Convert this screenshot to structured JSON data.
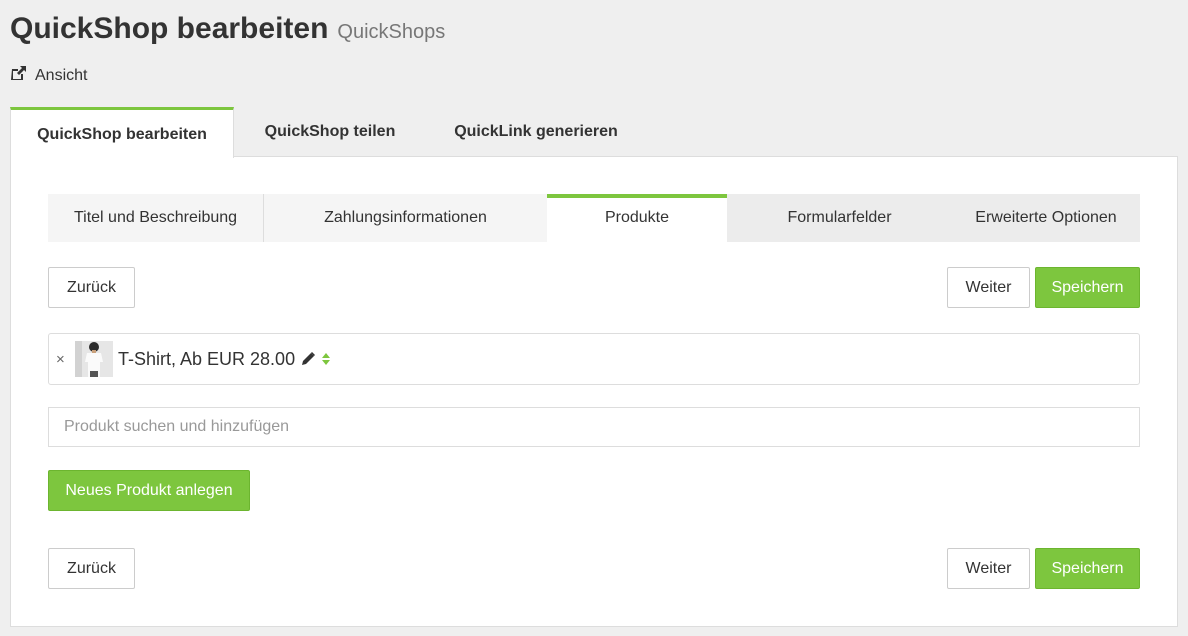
{
  "header": {
    "title": "QuickShop bearbeiten",
    "subtitle": "QuickShops",
    "view_link": "Ansicht"
  },
  "main_tabs": [
    {
      "label": "QuickShop bearbeiten",
      "active": true
    },
    {
      "label": "QuickShop teilen",
      "active": false
    },
    {
      "label": "QuickLink generieren",
      "active": false
    }
  ],
  "sub_tabs": [
    {
      "label": "Titel und Beschreibung",
      "active": false
    },
    {
      "label": "Zahlungsinformationen",
      "active": false
    },
    {
      "label": "Produkte",
      "active": true
    },
    {
      "label": "Formularfelder",
      "active": false
    },
    {
      "label": "Erweiterte Optionen",
      "active": false
    }
  ],
  "actions": {
    "back": "Zurück",
    "next": "Weiter",
    "save": "Speichern",
    "new_product": "Neues Produkt anlegen"
  },
  "products": [
    {
      "label": "T-Shirt, Ab EUR 28.00",
      "remove": "×"
    }
  ],
  "search": {
    "placeholder": "Produkt suchen und hinzufügen",
    "value": ""
  },
  "colors": {
    "accent": "#7dc63e",
    "background": "#efefef",
    "panel": "#ffffff"
  },
  "icons": {
    "view": "external-link-icon",
    "edit": "pencil-icon",
    "sort": "sort-arrows-icon",
    "remove": "close-icon"
  }
}
